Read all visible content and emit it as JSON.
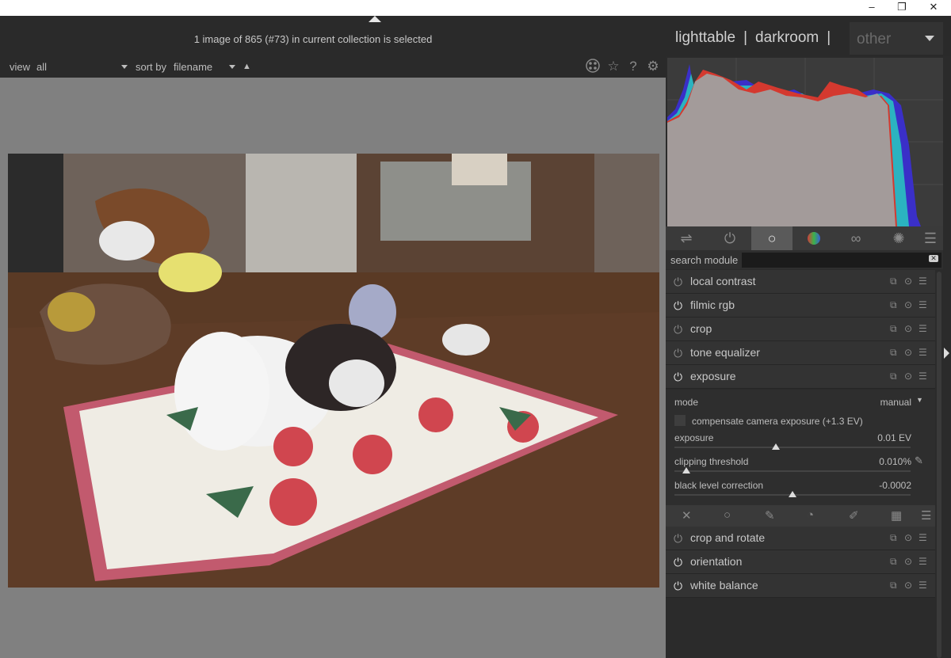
{
  "window_controls": {
    "minimize": "–",
    "restore": "❐",
    "close": "✕"
  },
  "header": {
    "status_text": "1 image of 865 (#73) in current collection is selected",
    "views": [
      "lighttable",
      "darkroom",
      "other"
    ],
    "separator": "|"
  },
  "filterbar": {
    "view_label": "view",
    "view_value": "all",
    "sort_label": "sort by",
    "sort_value": "filename",
    "sort_direction_icon": "▲",
    "icons": [
      "grouping-icon",
      "star-icon",
      "help-icon",
      "gear-icon"
    ]
  },
  "histogram": {
    "present": true
  },
  "module_tabs": {
    "icons": [
      "presets-icon",
      "active-modules-icon",
      "base-modules-icon",
      "color-modules-icon",
      "correct-modules-icon",
      "effects-modules-icon",
      "menu-icon"
    ],
    "active_index": 2
  },
  "search": {
    "label": "search module",
    "value": ""
  },
  "modules_top": [
    {
      "name": "local contrast",
      "enabled": false
    },
    {
      "name": "filmic rgb",
      "enabled": true
    },
    {
      "name": "crop",
      "enabled": false
    },
    {
      "name": "tone equalizer",
      "enabled": false
    },
    {
      "name": "exposure",
      "enabled": true
    }
  ],
  "exposure": {
    "mode_label": "mode",
    "mode_value": "manual",
    "compensate_label": "compensate camera exposure (+1.3 EV)",
    "compensate_checked": false,
    "exposure_label": "exposure",
    "exposure_value": "0.01 EV",
    "exposure_level": 0.43,
    "clipping_label": "clipping threshold",
    "clipping_value": "0.010%",
    "clipping_level": 0.05,
    "black_label": "black level correction",
    "black_value": "-0.0002",
    "black_level": 0.5
  },
  "modules_bottom": [
    {
      "name": "crop and rotate",
      "enabled": false
    },
    {
      "name": "orientation",
      "enabled": true
    },
    {
      "name": "white balance",
      "enabled": true
    }
  ]
}
